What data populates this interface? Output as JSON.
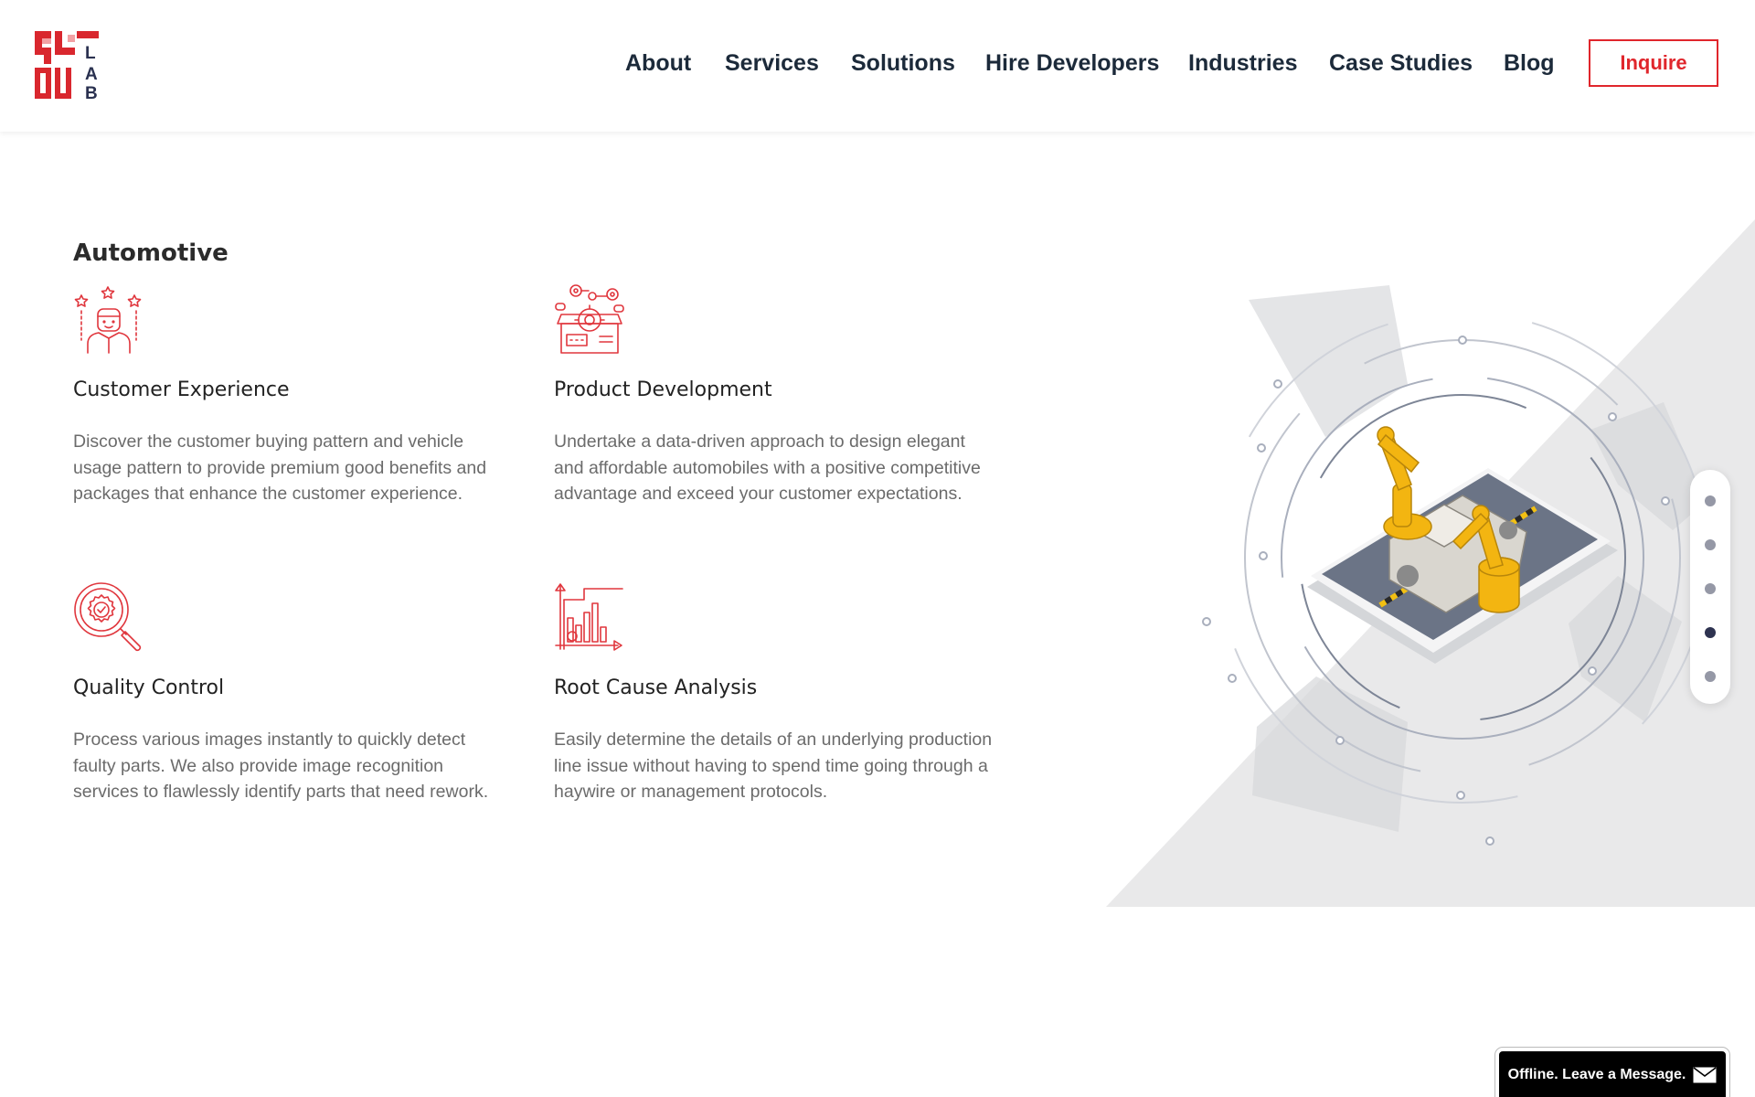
{
  "brand": {
    "logo_letters": [
      "L",
      "A",
      "B"
    ],
    "accent_color": "#e0262c",
    "nav_text_color": "#1c2a3a"
  },
  "nav": {
    "items": [
      "About",
      "Services",
      "Solutions",
      "Hire Developers",
      "Industries",
      "Case Studies",
      "Blog"
    ],
    "cta": "Inquire"
  },
  "section": {
    "title": "Automotive",
    "features": [
      {
        "icon": "customer-experience-icon",
        "title": "Customer Experience",
        "description": "Discover the customer buying pattern and vehicle usage pattern to provide premium good benefits and packages that enhance the customer experience."
      },
      {
        "icon": "product-development-icon",
        "title": "Product Development",
        "description": "Undertake a data-driven approach to design elegant and affordable automobiles with a positive competitive advantage and exceed your customer expectations."
      },
      {
        "icon": "quality-control-icon",
        "title": "Quality Control",
        "description": "Process various images instantly to quickly detect faulty parts. We also provide image recognition services to flawlessly identify parts that need rework."
      },
      {
        "icon": "root-cause-analysis-icon",
        "title": "Root Cause Analysis",
        "description": "Easily determine the details of an underlying production line issue without having to spend time going through a haywire or management protocols."
      }
    ]
  },
  "illustration": {
    "name": "automotive-robot-assembly-illustration"
  },
  "slider": {
    "count": 5,
    "active_index": 3
  },
  "chat": {
    "label": "Offline. Leave a Message.",
    "icon": "envelope-icon"
  }
}
